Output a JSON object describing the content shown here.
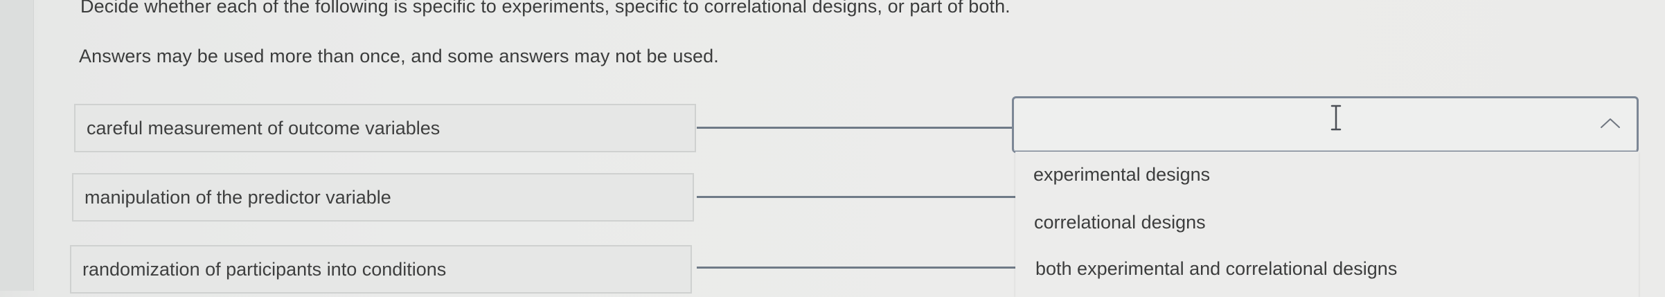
{
  "instructions": {
    "line1": "Decide whether each of the following is specific to experiments, specific to correlational designs, or part of both.",
    "line2": "Answers may be used more than once, and some answers may not be used."
  },
  "prompts": [
    "careful measurement of outcome variables",
    "manipulation of the predictor variable",
    "randomization of participants into conditions"
  ],
  "answer_select": {
    "value": "",
    "expanded": true,
    "icons": [
      "text-cursor-icon",
      "chevron-up-icon"
    ]
  },
  "dropdown_options": [
    "experimental designs",
    "correlational designs",
    "both experimental and correlational designs"
  ],
  "colors": {
    "text": "#3b3c3c",
    "select_border": "#7c8796",
    "connector": "#6f7a87"
  }
}
